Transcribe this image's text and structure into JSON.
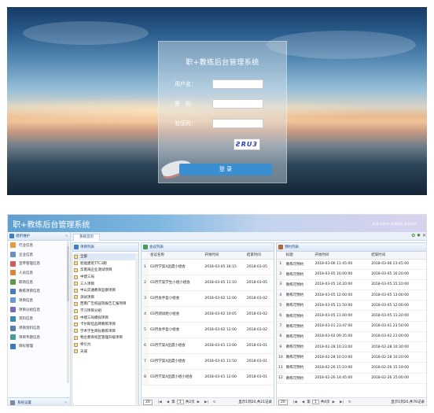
{
  "login": {
    "title": "职+教练后台管理系统",
    "username_label": "用户名：",
    "password_label": "密　码：",
    "captcha_label": "验证码：",
    "captcha_text": "ƧRU3",
    "login_button": "登 录"
  },
  "admin": {
    "app_title": "职+教练后台管理系统",
    "user_bar": "欢迎 admin  修改密码  安全退出",
    "sidebar": {
      "header": "组织维护",
      "items": [
        {
          "label": "行业信息",
          "color": "#e89a3c"
        },
        {
          "label": "企业信息",
          "color": "#6a8fc2"
        },
        {
          "label": "宣传管理信息",
          "color": "#d35a5a"
        },
        {
          "label": "人员信息",
          "color": "#d9883a"
        },
        {
          "label": "职场信息",
          "color": "#5a9a4a"
        },
        {
          "label": "教练项目信息",
          "color": "#4a7ac2"
        },
        {
          "label": "项目信息",
          "color": "#6a9ad2"
        },
        {
          "label": "项目分组信息",
          "color": "#7a6ac2"
        },
        {
          "label": "资料信息",
          "color": "#3a8ab2"
        },
        {
          "label": "项目资料信息",
          "color": "#5a7ab2"
        },
        {
          "label": "项目专题信息",
          "color": "#4a9a9a"
        },
        {
          "label": "目标管理",
          "color": "#3a7ac2"
        }
      ],
      "footer": "系统设置"
    },
    "tab_label": "系统首页",
    "project_pane": {
      "title": "项目列表",
      "items": [
        "全部",
        "智能建筑TTC3期",
        "华南海企业测试项目",
        "中建三局",
        "三人项目",
        "中山交通教育监察项目",
        "测试项目",
        "西南广告校园等报告汇报项目",
        "学习项目分组",
        "中建三局模拟项目",
        "卡尔斯坦品牌教练项目",
        "学术学生目标教练项目",
        "物企教育校区管理升级项目",
        "牵引力",
        "天诚"
      ]
    },
    "meeting_pane": {
      "title": "会议列表",
      "columns": [
        "会议名称",
        "开始时间",
        "结束时间"
      ],
      "rows": [
        {
          "n": "1",
          "name": "03月学案X品盟小组会",
          "start": "2018-03-05 16:15",
          "end": "2018-03-05"
        },
        {
          "n": "2",
          "name": "03月学案学生小组小组会",
          "start": "2018-03-05 11:10",
          "end": "2018-03-05"
        },
        {
          "n": "3",
          "name": "03月会手盈小组会",
          "start": "2018-03-02 12:00",
          "end": "2018-03-02"
        },
        {
          "n": "4",
          "name": "03月测试组小组会",
          "start": "2018-03-02 10:05",
          "end": "2018-03-02"
        },
        {
          "n": "5",
          "name": "03月会手盈小组会",
          "start": "2018-03-02 12:00",
          "end": "2018-03-02"
        },
        {
          "n": "6",
          "name": "03月学案X品盟小组会",
          "start": "2018-03-01 13:00",
          "end": "2018-03-01"
        },
        {
          "n": "7",
          "name": "03月学案X品盟小组会",
          "start": "2018-03-01 11:50",
          "end": "2018-03-01"
        },
        {
          "n": "8",
          "name": "03月学案X品盟小组小组会",
          "start": "2018-03-01 12:00",
          "end": "2018-03-01"
        }
      ],
      "pager": {
        "size": "20",
        "page": "1",
        "pages": "共2页",
        "info": "显示1到20,共21记录"
      }
    },
    "reserve_pane": {
      "title": "预约列表",
      "columns": [
        "标题",
        "开始时间",
        "结束时间"
      ],
      "rows": [
        {
          "n": "1",
          "title": "教练可预约",
          "start": "2018-03-06 11:45:00",
          "end": "2018-03-06 23:45:00"
        },
        {
          "n": "2",
          "title": "教练可预约",
          "start": "2018-03-05 16:00:00",
          "end": "2018-03-05 16:20:00"
        },
        {
          "n": "3",
          "title": "教练可预约",
          "start": "2018-03-05 14:20:00",
          "end": "2018-03-05 15:10:00"
        },
        {
          "n": "4",
          "title": "教练可预约",
          "start": "2018-03-05 12:00:00",
          "end": "2018-03-05 13:00:00"
        },
        {
          "n": "5",
          "title": "教练可预约",
          "start": "2018-03-05 11:50:00",
          "end": "2018-03-05 12:00:00"
        },
        {
          "n": "6",
          "title": "教练可预约",
          "start": "2018-03-05 11:00:00",
          "end": "2018-03-05 11:20:00"
        },
        {
          "n": "7",
          "title": "教练可预约",
          "start": "2018-03-01 23:47:00",
          "end": "2018-03-01 23:50:00"
        },
        {
          "n": "8",
          "title": "教练可预约",
          "start": "2018-03-02 09:35:00",
          "end": "2018-03-02 23:00:00"
        },
        {
          "n": "9",
          "title": "教练可预约",
          "start": "2018-02-28 10:23:00",
          "end": "2018-02-28 10:30:00"
        },
        {
          "n": "10",
          "title": "教练可预约",
          "start": "2018-02-28 10:10:00",
          "end": "2018-02-28 10:20:00"
        },
        {
          "n": "11",
          "title": "教练可预约",
          "start": "2018-02-26 15:10:00",
          "end": "2018-02-26 15:19:00"
        },
        {
          "n": "12",
          "title": "教练可预约",
          "start": "2018-02-26 14:45:00",
          "end": "2018-02-26 15:00:00"
        }
      ],
      "pager": {
        "size": "20",
        "page": "1",
        "pages": "共4页",
        "info": "显示1到20,共76记录"
      }
    }
  }
}
